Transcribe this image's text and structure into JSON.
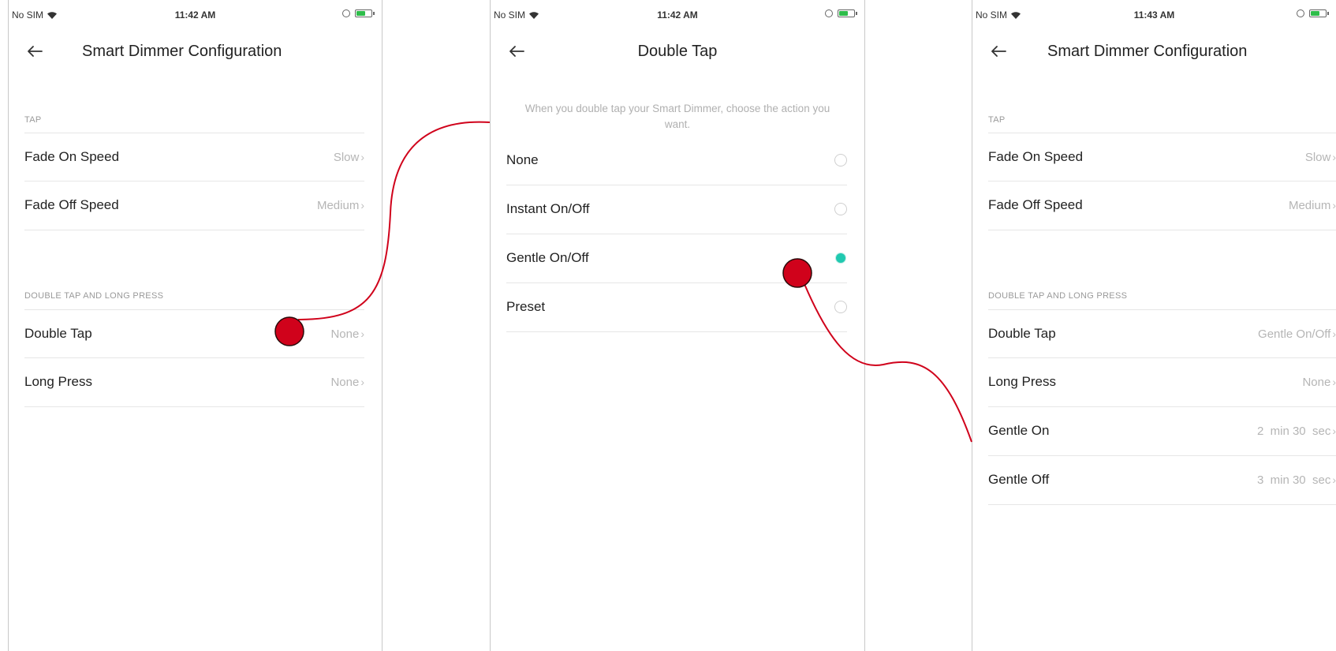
{
  "colors": {
    "accent_teal": "#20c9b0",
    "annotation_red": "#d0021b",
    "muted_text": "#b5b5b5"
  },
  "screens": [
    {
      "status": {
        "carrier": "No SIM",
        "time": "11:42 AM"
      },
      "title": "Smart Dimmer Configuration",
      "sections": [
        {
          "label": "TAP",
          "rows": [
            {
              "label": "Fade On Speed",
              "value": "Slow"
            },
            {
              "label": "Fade Off Speed",
              "value": "Medium"
            }
          ]
        },
        {
          "label": "DOUBLE TAP AND LONG PRESS",
          "rows": [
            {
              "label": "Double Tap",
              "value": "None"
            },
            {
              "label": "Long Press",
              "value": "None"
            }
          ]
        }
      ]
    },
    {
      "status": {
        "carrier": "No SIM",
        "time": "11:42 AM"
      },
      "title": "Double Tap",
      "description": "When you double tap your Smart Dimmer, choose the action you want.",
      "options": [
        {
          "label": "None",
          "selected": false
        },
        {
          "label": "Instant On/Off",
          "selected": false
        },
        {
          "label": "Gentle On/Off",
          "selected": true
        },
        {
          "label": "Preset",
          "selected": false
        }
      ]
    },
    {
      "status": {
        "carrier": "No SIM",
        "time": "11:43 AM"
      },
      "title": "Smart Dimmer Configuration",
      "sections": [
        {
          "label": "TAP",
          "rows": [
            {
              "label": "Fade On Speed",
              "value": "Slow"
            },
            {
              "label": "Fade Off Speed",
              "value": "Medium"
            }
          ]
        },
        {
          "label": "DOUBLE TAP AND LONG PRESS",
          "rows": [
            {
              "label": "Double Tap",
              "value": "Gentle On/Off"
            },
            {
              "label": "Long Press",
              "value": "None"
            },
            {
              "label": "Gentle On",
              "value": "2  min 30  sec"
            },
            {
              "label": "Gentle Off",
              "value": "3  min 30  sec"
            }
          ]
        }
      ]
    }
  ]
}
